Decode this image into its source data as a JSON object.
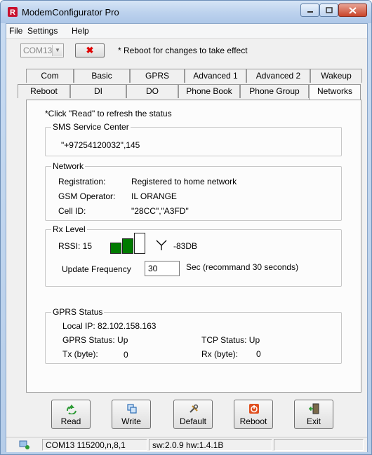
{
  "window": {
    "title": "ModemConfigurator Pro"
  },
  "menu": [
    "File",
    "Settings",
    "Help"
  ],
  "toolbar": {
    "port_value": "COM13",
    "cancel_label": "✖",
    "reboot_note": "* Reboot for changes to take effect"
  },
  "tabs": {
    "row1": [
      "Com",
      "Basic",
      "GPRS",
      "Advanced 1",
      "Advanced 2",
      "Wakeup"
    ],
    "row2": [
      "Reboot",
      "DI",
      "DO",
      "Phone Book",
      "Phone Group",
      "Networks"
    ],
    "active": "Networks"
  },
  "networks": {
    "hint": "*Click \"Read\" to refresh the status",
    "sms": {
      "legend": "SMS Service Center",
      "value": "\"+97254120032\",145"
    },
    "network": {
      "legend": "Network",
      "registration_label": "Registration:",
      "registration_value": "Registered to home network",
      "operator_label": "GSM Operator:",
      "operator_value": "IL ORANGE",
      "cell_label": "Cell ID:",
      "cell_value": "\"28CC\",\"A3FD\""
    },
    "rx": {
      "legend": "Rx Level",
      "rssi_label": "RSSI: 15",
      "db_value": "-83DB",
      "signal_bars_filled": 2,
      "signal_bars_total": 3,
      "freq_label": "Update Frequency",
      "freq_value": "30",
      "freq_note": "Sec (recommand 30 seconds)"
    },
    "gprs": {
      "legend": "GPRS Status",
      "local_ip": "Local IP:  82.102.158.163",
      "gprs_status": "GPRS Status:  Up",
      "tcp_status": "TCP Status:  Up",
      "tx_label": "Tx (byte):",
      "tx_value": "0",
      "rx_label": "Rx (byte):",
      "rx_value": "0"
    }
  },
  "buttons": {
    "read": "Read",
    "write": "Write",
    "default": "Default",
    "reboot": "Reboot",
    "exit": "Exit"
  },
  "status": {
    "connection": "COM13 115200,n,8,1",
    "version": "sw:2.0.9 hw:1.4.1B"
  },
  "colors": {
    "signal_green": "#007a00",
    "cancel_red": "#e00000",
    "reboot_orange": "#e05020"
  }
}
